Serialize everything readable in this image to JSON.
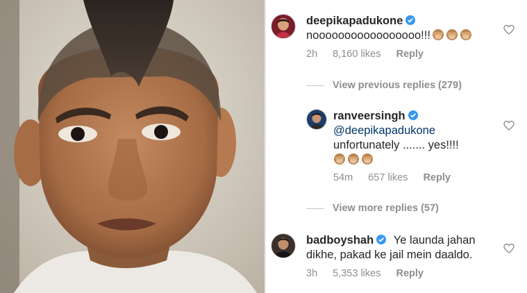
{
  "comments": [
    {
      "username": "deepikapadukone",
      "text": "nooooooooooooooooo!!!",
      "emoji_count": 3,
      "emoji": "see-no-evil-monkey",
      "time": "2h",
      "likes": "8,160 likes",
      "reply_label": "Reply"
    },
    {
      "username": "ranveersingh",
      "mention": "@deepikapadukone",
      "text": "unfortunately ....... yes!!!!",
      "emoji_count": 3,
      "emoji": "see-no-evil-monkey",
      "time": "54m",
      "likes": "657 likes",
      "reply_label": "Reply"
    },
    {
      "username": "badboyshah",
      "text_line1": "Ye launda jahan",
      "text_line2": "dikhe, pakad ke jail mein daaldo.",
      "time": "3h",
      "likes": "5,353 likes",
      "reply_label": "Reply"
    }
  ],
  "threads": {
    "previous_replies": "View previous replies (279)",
    "more_replies": "View more replies (57)"
  },
  "colors": {
    "verified": "#3897f0",
    "meta": "#8e8e8e",
    "text": "#262626"
  }
}
